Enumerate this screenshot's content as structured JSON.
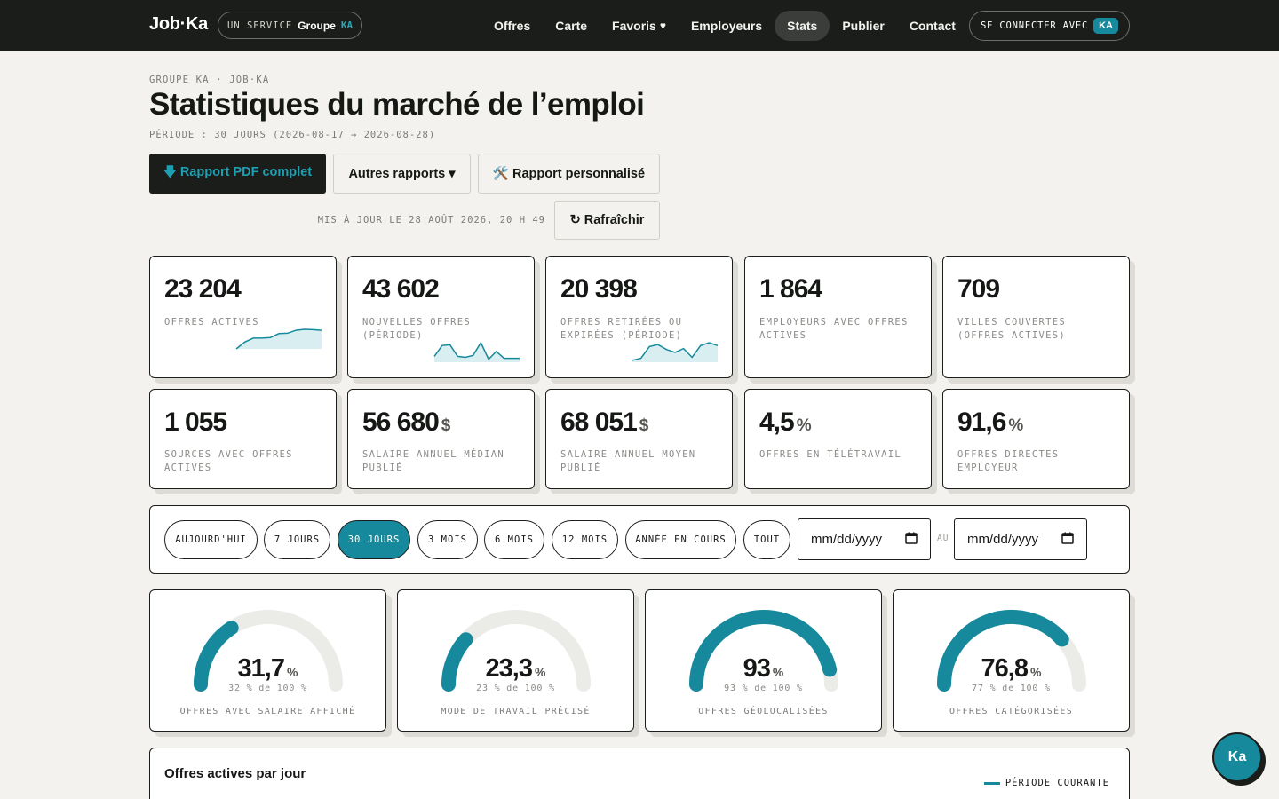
{
  "nav": {
    "logo": "Job·Ka",
    "service_label": "UN SERVICE",
    "service_group": "Groupe",
    "service_ka": "KA",
    "items": [
      {
        "label": "Offres",
        "icon": ""
      },
      {
        "label": "Carte",
        "icon": ""
      },
      {
        "label": "Favoris",
        "icon": "♥"
      },
      {
        "label": "Employeurs",
        "icon": ""
      },
      {
        "label": "Stats",
        "icon": "",
        "active": true
      },
      {
        "label": "Publier",
        "icon": ""
      },
      {
        "label": "Contact",
        "icon": ""
      }
    ],
    "login_label": "SE CONNECTER AVEC",
    "login_badge": "KA"
  },
  "header": {
    "breadcrumb": "GROUPE KA · JOB·KA",
    "title": "Statistiques du marché de l’emploi",
    "period": "PÉRIODE : 30 JOURS (2026-08-17 → 2026-08-28)"
  },
  "actions": {
    "pdf_label": "🡇 Rapport PDF complet",
    "other_label": "Autres rapports ▾",
    "custom_label": "🛠️ Rapport personnalisé",
    "updated": "MIS À JOUR LE 28 AOÛT 2026, 20 H 49",
    "refresh_label": "↻ Rafraîchir"
  },
  "kpis": [
    {
      "value": "23 204",
      "unit": "",
      "label": "Offres actives",
      "spark": [
        0.0,
        0.35,
        0.55,
        0.55,
        0.58,
        0.78,
        0.8,
        0.95,
        1.0,
        0.98,
        0.95
      ]
    },
    {
      "value": "43 602",
      "unit": "",
      "label": "Nouvelles offres (période)",
      "spark": [
        0.3,
        0.85,
        0.9,
        0.3,
        0.25,
        0.35,
        1.0,
        0.15,
        0.55,
        0.2,
        0.2,
        0.2
      ]
    },
    {
      "value": "20 398",
      "unit": "",
      "label": "Offres retirées ou expirées (période)",
      "spark": [
        0.1,
        0.2,
        0.8,
        0.9,
        0.65,
        0.5,
        0.7,
        0.25,
        0.85,
        1.0,
        0.85
      ]
    },
    {
      "value": "1 864",
      "unit": "",
      "label": "Employeurs avec offres actives",
      "spark": []
    },
    {
      "value": "709",
      "unit": "",
      "label": "Villes couvertes (offres actives)",
      "spark": []
    },
    {
      "value": "1 055",
      "unit": "",
      "label": "Sources avec offres actives",
      "spark": []
    },
    {
      "value": "56 680",
      "unit": "$",
      "label": "Salaire annuel médian publié",
      "spark": []
    },
    {
      "value": "68 051",
      "unit": "$",
      "label": "Salaire annuel moyen publié",
      "spark": []
    },
    {
      "value": "4,5",
      "unit": "%",
      "label": "Offres en télétravail",
      "spark": []
    },
    {
      "value": "91,6",
      "unit": "%",
      "label": "Offres directes employeur",
      "spark": []
    }
  ],
  "filters": {
    "chips": [
      {
        "label": "AUJOURD'HUI",
        "active": false
      },
      {
        "label": "7 JOURS",
        "active": false
      },
      {
        "label": "30 JOURS",
        "active": true
      },
      {
        "label": "3 MOIS",
        "active": false
      },
      {
        "label": "6 MOIS",
        "active": false
      },
      {
        "label": "12 MOIS",
        "active": false
      },
      {
        "label": "ANNÉE EN COURS",
        "active": false
      },
      {
        "label": "TOUT",
        "active": false
      }
    ],
    "date_from_placeholder": "mm/dd/yyyy",
    "date_to_placeholder": "mm/dd/yyyy",
    "separator": "AU"
  },
  "gauges": [
    {
      "value": "31,7",
      "pct": 31.7,
      "sub": "32 % de 100 %",
      "label": "OFFRES AVEC SALAIRE AFFICHÉ"
    },
    {
      "value": "23,3",
      "pct": 23.3,
      "sub": "23 % de 100 %",
      "label": "MODE DE TRAVAIL PRÉCISÉ"
    },
    {
      "value": "93",
      "pct": 93,
      "sub": "93 % de 100 %",
      "label": "OFFRES GÉOLOCALISÉES"
    },
    {
      "value": "76,8",
      "pct": 76.8,
      "sub": "77 % de 100 %",
      "label": "OFFRES CATÉGORISÉES"
    }
  ],
  "gauge_unit": "%",
  "chart": {
    "title": "Offres actives par jour",
    "legend": "PÉRIODE COURANTE"
  },
  "fab_label": "Ka",
  "colors": {
    "accent": "#168a9c",
    "dark": "#1b1d1a",
    "bg": "#f3f2ee"
  }
}
